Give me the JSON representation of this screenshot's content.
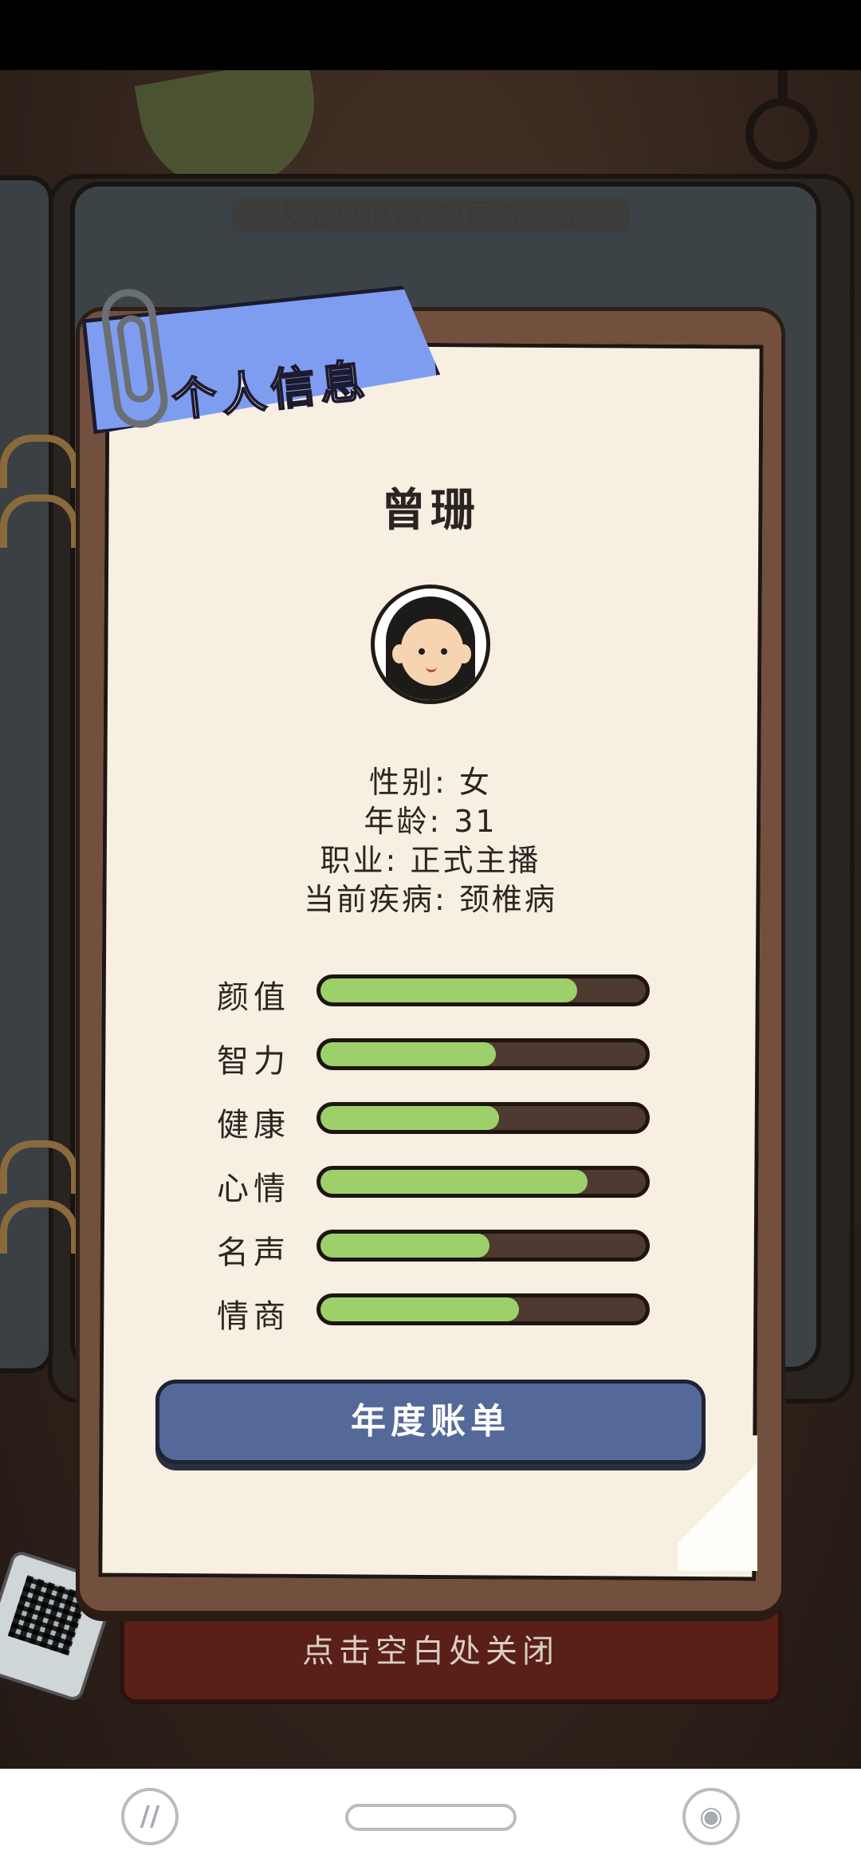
{
  "background_title": "人生模拟器:中国式人生",
  "panel": {
    "ribbon_title": "个人信息",
    "name": "曾珊",
    "info": {
      "gender": "性别: 女",
      "age": "年龄: 31",
      "job": "职业: 正式主播",
      "disease": "当前疾病: 颈椎病"
    },
    "stats": [
      {
        "label": "颜值",
        "value": 0.79
      },
      {
        "label": "智力",
        "value": 0.54
      },
      {
        "label": "健康",
        "value": 0.55
      },
      {
        "label": "心情",
        "value": 0.82
      },
      {
        "label": "名声",
        "value": 0.52
      },
      {
        "label": "情商",
        "value": 0.61
      }
    ],
    "button_label": "年度账单"
  },
  "close_hint": "点击空白处关闭",
  "nav": {
    "left_icon": "app-switch-icon",
    "home_icon": "home-pill-icon",
    "right_icon": "assistant-icon"
  },
  "colors": {
    "ribbon": "#7e9df1",
    "bar_fill": "#9dd06a",
    "bar_track": "#4e3a30",
    "button": "#54699a"
  }
}
